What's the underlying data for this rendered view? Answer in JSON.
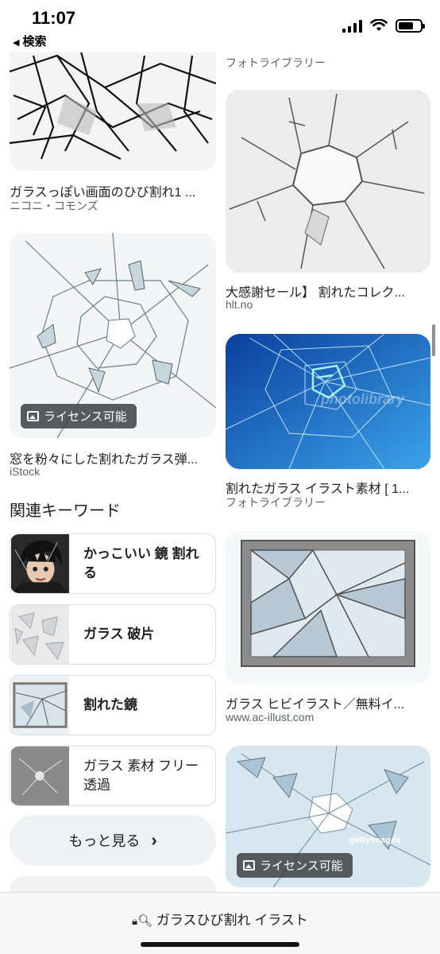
{
  "status_bar": {
    "time": "11:07",
    "back_label": "検索"
  },
  "left_column": {
    "card1": {
      "title": "ガラスっぽい画面のひび割れ1 ...",
      "source": "ニコニ・コモンズ"
    },
    "card2": {
      "title": "窓を粉々にした割れたガラス弾...",
      "source": "iStock",
      "badge": "ライセンス可能"
    }
  },
  "right_column": {
    "card0": {
      "source": "フォトライブラリー"
    },
    "card1": {
      "title": "大感謝セール】 割れたコレク...",
      "source": "hlt.no"
    },
    "card2": {
      "title": "割れたガラス イラスト素材 [ 1...",
      "source": "フォトライブラリー",
      "watermark": "photolibrary"
    },
    "card3": {
      "title": "ガラス ヒビイラスト／無料イ...",
      "source": "www.ac-illust.com"
    },
    "card4": {
      "badge": "ライセンス可能",
      "watermark": "gettyimages"
    }
  },
  "related": {
    "heading": "関連キーワード",
    "items": [
      {
        "label": "かっこいい 鏡 割れる",
        "bold": true
      },
      {
        "label": "ガラス 破片",
        "bold": true
      },
      {
        "label": "割れた鏡",
        "bold": true
      },
      {
        "label": "ガラス 素材 フリー 透過",
        "bold": false
      }
    ],
    "more_label": "もっと見る"
  },
  "bottom_bar": {
    "query": "ガラスひび割れ イラスト"
  }
}
